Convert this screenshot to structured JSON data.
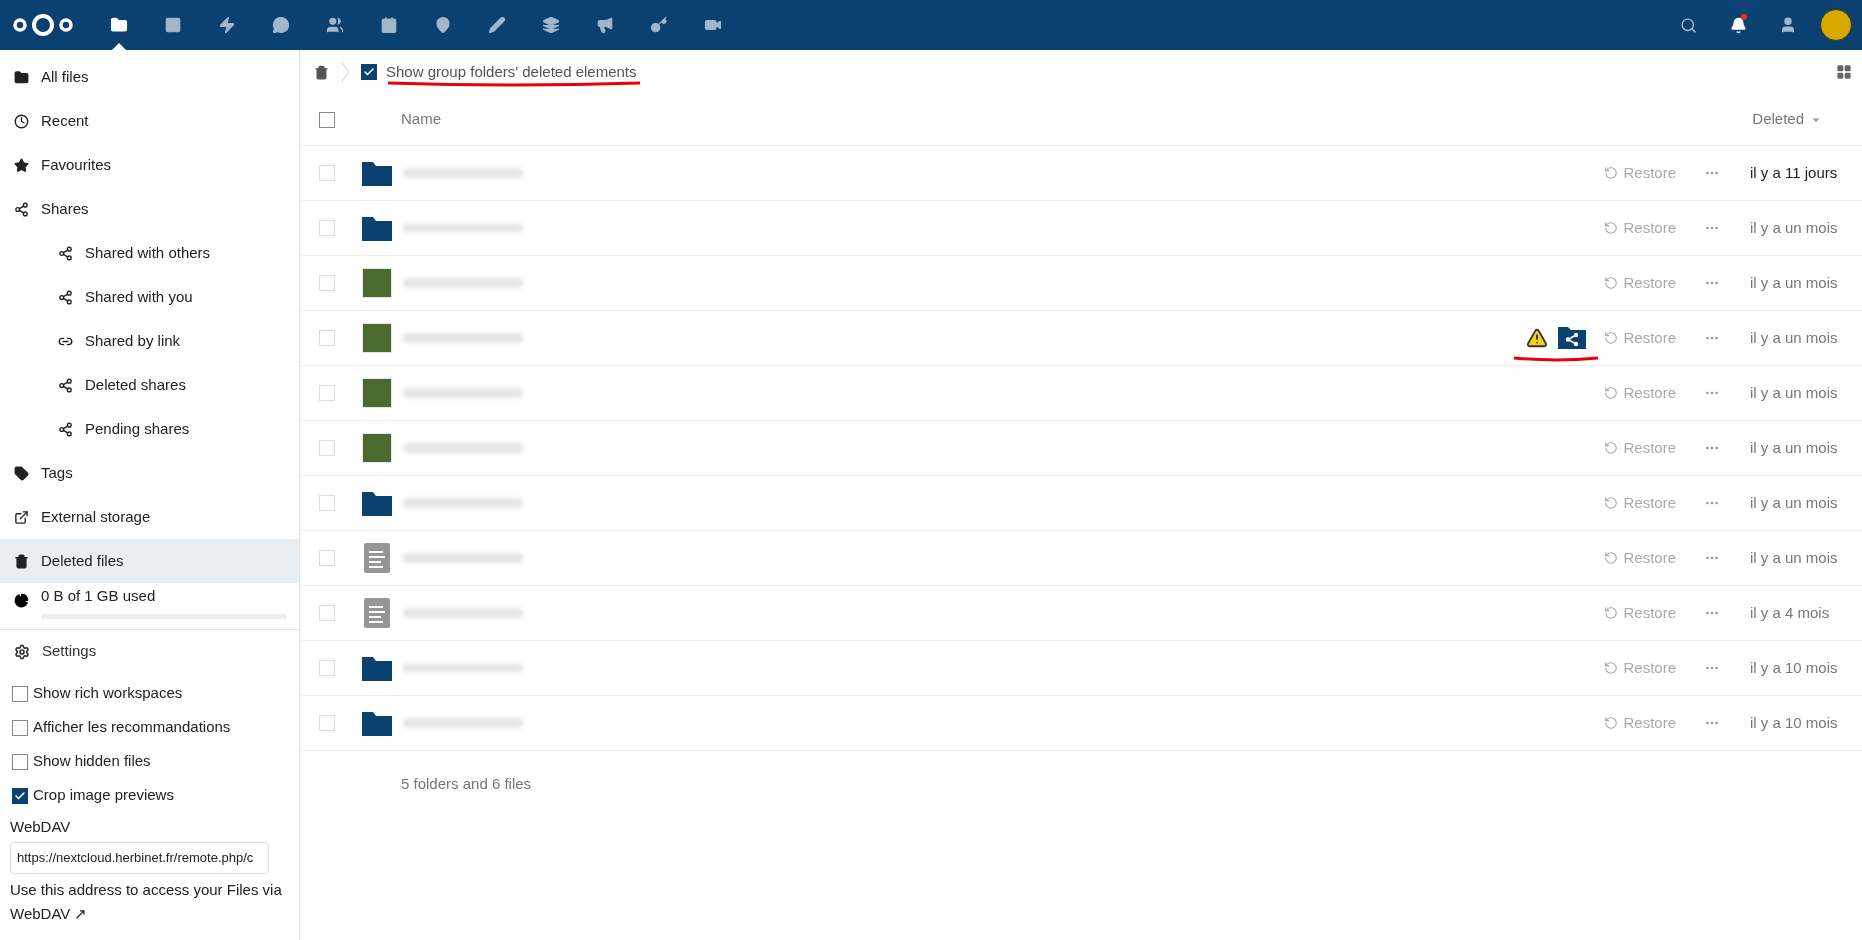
{
  "top_bar": {
    "apps": [
      {
        "kind": "files",
        "selected": true
      },
      {
        "kind": "photos",
        "selected": false
      },
      {
        "kind": "activity",
        "selected": false
      },
      {
        "kind": "talk",
        "selected": false
      },
      {
        "kind": "contacts",
        "selected": false
      },
      {
        "kind": "calendar",
        "selected": false
      },
      {
        "kind": "maps",
        "selected": false
      },
      {
        "kind": "notes",
        "selected": false
      },
      {
        "kind": "deck",
        "selected": false
      },
      {
        "kind": "announcements",
        "selected": false
      },
      {
        "kind": "passwords",
        "selected": false
      },
      {
        "kind": "video",
        "selected": false
      }
    ],
    "notifications_unread": true
  },
  "sidebar": {
    "items": [
      {
        "kind": "folder",
        "label": "All files",
        "selected": false
      },
      {
        "kind": "clock",
        "label": "Recent",
        "selected": false
      },
      {
        "kind": "star",
        "label": "Favourites",
        "selected": false
      },
      {
        "kind": "share",
        "label": "Shares",
        "selected": false,
        "children": [
          {
            "kind": "share",
            "label": "Shared with others",
            "selected": false
          },
          {
            "kind": "share",
            "label": "Shared with you",
            "selected": false
          },
          {
            "kind": "link",
            "label": "Shared by link",
            "selected": false
          },
          {
            "kind": "share-deleted",
            "label": "Deleted shares",
            "selected": false
          },
          {
            "kind": "share",
            "label": "Pending shares",
            "selected": false
          }
        ]
      },
      {
        "kind": "tag",
        "label": "Tags",
        "selected": false
      },
      {
        "kind": "external",
        "label": "External storage",
        "selected": false
      },
      {
        "kind": "trash",
        "label": "Deleted files",
        "selected": true
      }
    ],
    "storage": {
      "label": "0 B of 1 GB used",
      "level": 0
    },
    "settings": {
      "label": "Settings",
      "options": [
        {
          "label": "Show rich workspaces",
          "checked": false
        },
        {
          "label": "Afficher les recommandations",
          "checked": false
        },
        {
          "label": "Show hidden files",
          "checked": false
        },
        {
          "label": "Crop image previews",
          "checked": true
        }
      ],
      "webdav": {
        "label": "WebDAV",
        "value": "https://nextcloud.herbinet.fr/remote.php/c",
        "help": "Use this address to access your Files via",
        "link": "WebDAV ↗"
      }
    }
  },
  "toolbar": {
    "show_group_folders": {
      "label": "Show group folders' deleted elements",
      "checked": true
    }
  },
  "table": {
    "select_all": {
      "checked": false
    },
    "columns": {
      "name": "Name",
      "deleted": "Deleted"
    },
    "rows": [
      {
        "kind": "folder",
        "checked": false,
        "warning": false,
        "shared": false,
        "restore": "Restore",
        "deleted": "il y a 11 jours",
        "emphasized": true
      },
      {
        "kind": "folder",
        "checked": false,
        "warning": false,
        "shared": false,
        "restore": "Restore",
        "deleted": "il y a un mois",
        "emphasized": false
      },
      {
        "kind": "image",
        "checked": false,
        "warning": false,
        "shared": false,
        "restore": "Restore",
        "deleted": "il y a un mois",
        "emphasized": false
      },
      {
        "kind": "image",
        "checked": false,
        "warning": true,
        "shared": true,
        "restore": "Restore",
        "deleted": "il y a un mois",
        "emphasized": false
      },
      {
        "kind": "image",
        "checked": false,
        "warning": false,
        "shared": false,
        "restore": "Restore",
        "deleted": "il y a un mois",
        "emphasized": false
      },
      {
        "kind": "image",
        "checked": false,
        "warning": false,
        "shared": false,
        "restore": "Restore",
        "deleted": "il y a un mois",
        "emphasized": false
      },
      {
        "kind": "folder",
        "checked": false,
        "warning": false,
        "shared": false,
        "restore": "Restore",
        "deleted": "il y a un mois",
        "emphasized": false
      },
      {
        "kind": "document",
        "checked": false,
        "warning": false,
        "shared": false,
        "restore": "Restore",
        "deleted": "il y a un mois",
        "emphasized": false
      },
      {
        "kind": "document",
        "checked": false,
        "warning": false,
        "shared": false,
        "restore": "Restore",
        "deleted": "il y a 4 mois",
        "emphasized": false
      },
      {
        "kind": "folder",
        "checked": false,
        "warning": false,
        "shared": false,
        "restore": "Restore",
        "deleted": "il y a 10 mois",
        "emphasized": false
      },
      {
        "kind": "folder",
        "checked": false,
        "warning": false,
        "shared": false,
        "restore": "Restore",
        "deleted": "il y a 10 mois",
        "emphasized": false
      }
    ],
    "summary": "5 folders and 6 files"
  }
}
